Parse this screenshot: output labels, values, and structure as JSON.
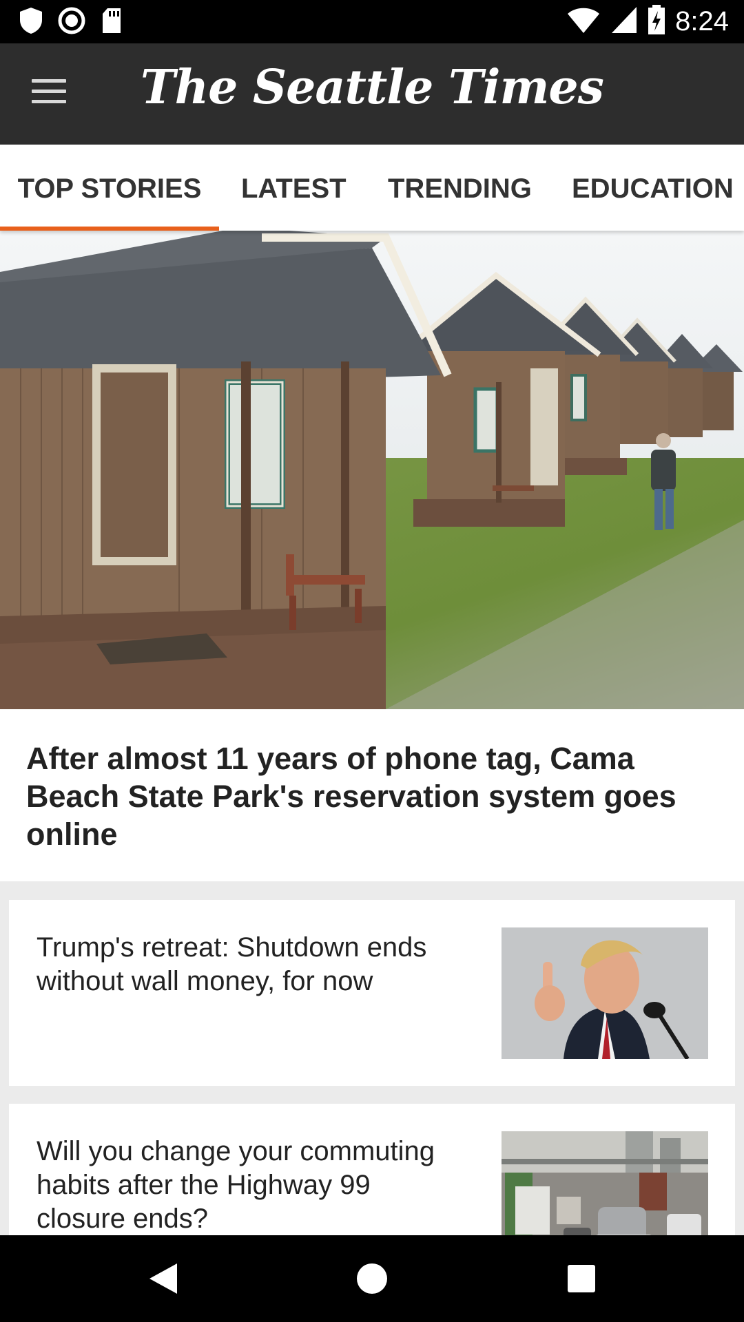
{
  "status_bar": {
    "time": "8:24",
    "icons": [
      "shield-icon",
      "record-icon",
      "sd-card-icon",
      "wifi-icon",
      "signal-icon",
      "battery-charging-icon"
    ]
  },
  "app_bar": {
    "menu_icon": "hamburger-menu-icon",
    "brand": "The Seattle Times"
  },
  "tabs": [
    {
      "label": "TOP STORIES",
      "active": true
    },
    {
      "label": "LATEST",
      "active": false
    },
    {
      "label": "TRENDING",
      "active": false
    },
    {
      "label": "EDUCATION",
      "active": false
    }
  ],
  "accent_color": "#e8601c",
  "hero": {
    "headline": "After almost 11 years of phone tag, Cama Beach State Park's reservation system goes online"
  },
  "stories": [
    {
      "headline": "Trump's retreat: Shutdown ends without wall money, for now"
    },
    {
      "headline": "Will you change your commuting habits after the Highway 99 closure ends?"
    }
  ],
  "nav_bar": {
    "icons": [
      "back-icon",
      "home-icon",
      "recents-icon"
    ]
  }
}
